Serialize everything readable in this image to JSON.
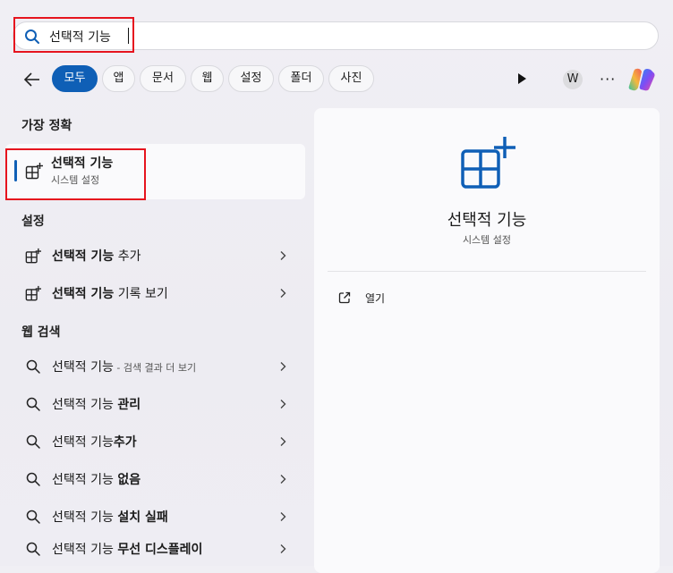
{
  "search": {
    "query": "선택적 기능"
  },
  "filters": [
    "모두",
    "앱",
    "문서",
    "웹",
    "설정",
    "폴더",
    "사진"
  ],
  "avatar_letter": "W",
  "more_label": "···",
  "sections": {
    "best_match": "가장 정확",
    "settings": "설정",
    "web": "웹 검색"
  },
  "best_match": {
    "title": "선택적 기능",
    "subtitle": "시스템 설정"
  },
  "settings_items": [
    {
      "bold": "선택적 기능",
      "rest": " 추가"
    },
    {
      "bold": "선택적 기능",
      "rest": " 기록 보기"
    }
  ],
  "web_items": [
    {
      "plain": "선택적 기능",
      "hint": " - 검색 결과 더 보기"
    },
    {
      "plain": "선택적 기능 ",
      "bold": "관리"
    },
    {
      "plain": "선택적 기능",
      "bold": "추가"
    },
    {
      "plain": "선택적 기능 ",
      "bold": "없음"
    },
    {
      "plain": "선택적 기능 ",
      "bold": "설치 실패"
    },
    {
      "plain": "선택적 기능 ",
      "bold": "무선 디스플레이"
    }
  ],
  "detail": {
    "title": "선택적 기능",
    "subtitle": "시스템 설정",
    "action_open": "열기"
  },
  "colors": {
    "accent": "#0f5fb6",
    "highlight": "#e6141e"
  }
}
